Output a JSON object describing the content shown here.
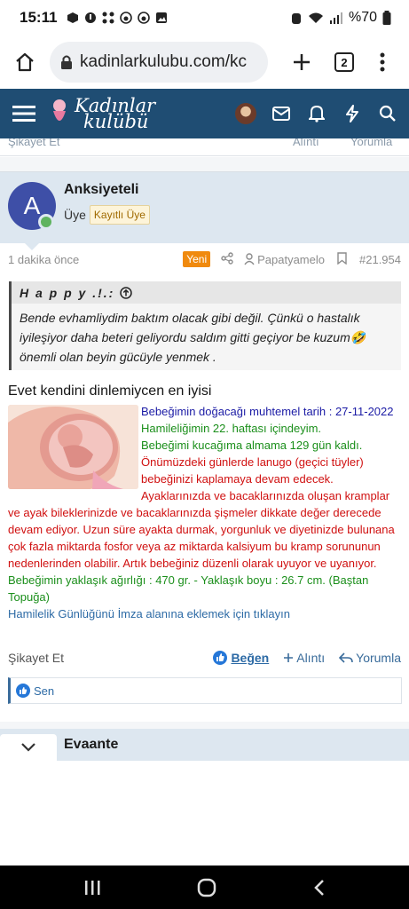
{
  "status_bar": {
    "time": "15:11",
    "battery": "%70",
    "icons": [
      "box-icon",
      "notification-icon",
      "grid-icon",
      "reddit-icon",
      "reddit-icon",
      "image-icon",
      "alarm-icon",
      "wifi-icon",
      "signal-icon",
      "battery-icon"
    ]
  },
  "browser": {
    "url": "kadinlarkulubu.com/kc",
    "tab_count": "2"
  },
  "site": {
    "logo_line1": "Kadınlar",
    "logo_line2": "kulübü",
    "header_color": "#1f4d73"
  },
  "prev_post": {
    "left_text": "Şikayet Et",
    "mid_text": "Alıntı",
    "right_text": "Yorumla"
  },
  "post": {
    "avatar_letter": "A",
    "avatar_color": "#3e4fa7",
    "username": "Anksiyeteli",
    "role": "Üye",
    "badge": "Kayıtlı Üye",
    "time_ago": "1 dakika önce",
    "new_badge": "Yeni",
    "liker_name": "Papatyamelo",
    "post_number": "#21.954",
    "quote": {
      "author": "H a p p y .!.:",
      "text": "Bende evhamliydim baktım olacak gibi değil. Çünkü o hastalık iyileşiyor daha beteri geliyordu saldım gitti geçiyor be kuzum🤣 önemli olan beyin gücüyle yenmek ."
    },
    "message": "Evet kendini dinlemiycen en iyisi",
    "signature": {
      "due_date": "Bebeğimin doğacağı muhtemel tarih : 27-11-2022",
      "week": "Hamileliğimin 22. haftası içindeyim.",
      "days_left": "Bebeğimi kucağıma almama 129 gün kaldı.",
      "info_lines": [
        "Önümüzdeki günlerde lanugo (geçici tüyler)",
        "bebeğinizi kaplamaya devam edecek."
      ],
      "red_text": "Ayaklarınızda ve bacaklarınızda oluşan kramplar ve ayak bileklerinizde ve bacaklarınızda şişmeler dikkate değer derecede devam ediyor. Uzun süre ayakta durmak, yorgunluk ve diyetinizde bulunana çok fazla miktarda fosfor veya az miktarda kalsiyum bu kramp sorununun nedenlerinden olabilir. Artık bebeğiniz düzenli olarak uyuyor ve uyanıyor.",
      "size": "Bebeğimin yaklaşık ağırlığı : 470 gr. - Yaklaşık boyu : 26.7 cm. (Baştan Topuğa)",
      "link": "Hamilelik Günlüğünü İmza alanına eklemek için tıklayın"
    },
    "actions": {
      "report": "Şikayet Et",
      "like": "Beğen",
      "quote": "Alıntı",
      "reply": "Yorumla"
    },
    "likes": "Sen"
  },
  "next_post": {
    "username": "Evaante"
  }
}
